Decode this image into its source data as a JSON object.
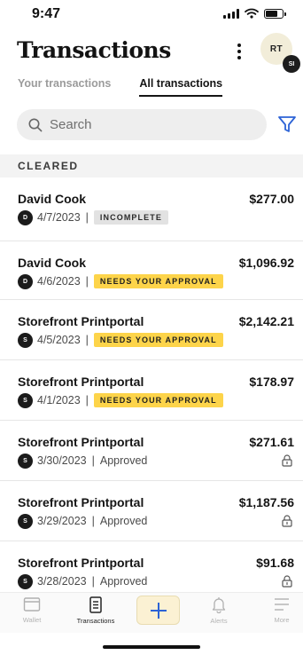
{
  "status_bar": {
    "time": "9:47"
  },
  "header": {
    "title": "Transactions",
    "avatar_initials": "RT",
    "sub_avatar_initials": "SI"
  },
  "tabs": [
    {
      "label": "Your transactions",
      "active": false
    },
    {
      "label": "All transactions",
      "active": true
    }
  ],
  "search": {
    "placeholder": "Search"
  },
  "section": {
    "label": "CLEARED"
  },
  "transactions": [
    {
      "name": "David Cook",
      "initial": "D",
      "date": "4/7/2023",
      "amount": "$277.00",
      "badge": "INCOMPLETE",
      "badge_color": "#e2e2e2"
    },
    {
      "name": "David Cook",
      "initial": "D",
      "date": "4/6/2023",
      "amount": "$1,096.92",
      "badge": "NEEDS YOUR APPROVAL",
      "badge_color": "#fdd44a"
    },
    {
      "name": "Storefront Printportal",
      "initial": "S",
      "date": "4/5/2023",
      "amount": "$2,142.21",
      "badge": "NEEDS YOUR APPROVAL",
      "badge_color": "#fdd44a"
    },
    {
      "name": "Storefront Printportal",
      "initial": "S",
      "date": "4/1/2023",
      "amount": "$178.97",
      "badge": "NEEDS YOUR APPROVAL",
      "badge_color": "#fdd44a"
    },
    {
      "name": "Storefront Printportal",
      "initial": "S",
      "date": "3/30/2023",
      "amount": "$271.61",
      "status": "Approved",
      "icon": "lock-icon"
    },
    {
      "name": "Storefront Printportal",
      "initial": "S",
      "date": "3/29/2023",
      "amount": "$1,187.56",
      "status": "Approved",
      "icon": "lock-icon"
    },
    {
      "name": "Storefront Printportal",
      "initial": "S",
      "date": "3/28/2023",
      "amount": "$91.68",
      "status": "Approved",
      "icon": "lock-icon"
    }
  ],
  "bottom_nav": {
    "items": [
      {
        "label": "Wallet",
        "icon": "wallet-icon",
        "active": false
      },
      {
        "label": "Transactions",
        "icon": "receipt-icon",
        "active": true
      },
      {
        "label": "",
        "icon": "plus-icon",
        "active": false
      },
      {
        "label": "Alerts",
        "icon": "bell-icon",
        "active": false
      },
      {
        "label": "More",
        "icon": "menu-icon",
        "active": false
      }
    ]
  },
  "colors": {
    "accent_yellow": "#fdd44a",
    "add_button_bg": "#fbf1d3",
    "plus_blue": "#2c63d6",
    "filter_blue": "#2c63d6"
  }
}
